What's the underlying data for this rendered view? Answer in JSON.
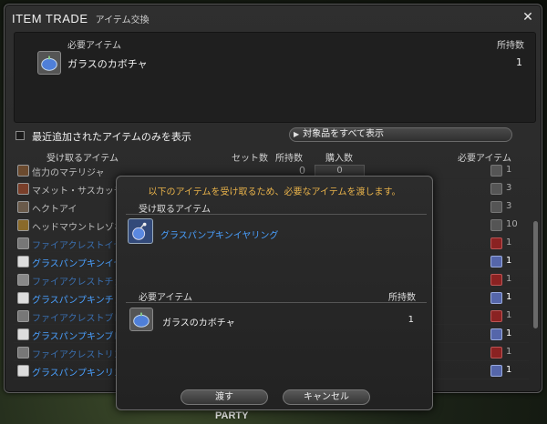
{
  "window": {
    "title": "ITEM TRADE",
    "subtitle": "アイテム交換",
    "close_icon": "close-x-icon"
  },
  "required_panel": {
    "header_item": "必要アイテム",
    "header_owned": "所持数",
    "item_name": "ガラスのカボチャ",
    "item_owned": "1"
  },
  "filter": {
    "label": "最近追加されたアイテムのみを表示",
    "show_all": "対象品をすべて表示"
  },
  "columns": {
    "receive": "受け取るアイテム",
    "set_count": "セット数",
    "owned": "所持数",
    "purchase": "購入数",
    "required": "必要アイテム"
  },
  "rows": [
    {
      "name": "信力のマテリジャ",
      "owned": "0",
      "buy": "0",
      "need": "1",
      "style": "dim"
    },
    {
      "name": "マメット・サスカッチ",
      "owned": "",
      "buy": "",
      "need": "3",
      "style": "dim"
    },
    {
      "name": "ヘクトアイ",
      "owned": "",
      "buy": "",
      "need": "3",
      "style": "dim"
    },
    {
      "name": "ヘッドマウントレゾネー",
      "owned": "",
      "buy": "",
      "need": "10",
      "style": "dim"
    },
    {
      "name": "ファイアクレストイヤ",
      "owned": "",
      "buy": "",
      "need": "1",
      "style": "dim-blue"
    },
    {
      "name": "グラスパンプキンイヤ",
      "owned": "",
      "buy": "",
      "need": "1",
      "style": "blue"
    },
    {
      "name": "ファイアクレストチョ",
      "owned": "",
      "buy": "",
      "need": "1",
      "style": "dim-blue"
    },
    {
      "name": "グラスパンプキンチョー",
      "owned": "",
      "buy": "",
      "need": "1",
      "style": "blue"
    },
    {
      "name": "ファイアクレストブレ",
      "owned": "",
      "buy": "",
      "need": "1",
      "style": "dim-blue"
    },
    {
      "name": "グラスパンプキンブレ",
      "owned": "",
      "buy": "",
      "need": "1",
      "style": "blue"
    },
    {
      "name": "ファイアクレストリン",
      "owned": "",
      "buy": "",
      "need": "1",
      "style": "dim-blue"
    },
    {
      "name": "グラスパンプキンリン",
      "owned": "",
      "buy": "",
      "need": "1",
      "style": "blue"
    }
  ],
  "modal": {
    "message": "以下のアイテムを受け取るため、必要なアイテムを渡します。",
    "receive_header": "受け取るアイテム",
    "receive_item": "グラスパンプキンイヤリング",
    "required_header": "必要アイテム",
    "owned_header": "所持数",
    "give_item": "ガラスのカボチャ",
    "give_qty": "1",
    "ok_label": "渡す",
    "cancel_label": "キャンセル"
  },
  "hud": {
    "party_label": "PARTY"
  }
}
